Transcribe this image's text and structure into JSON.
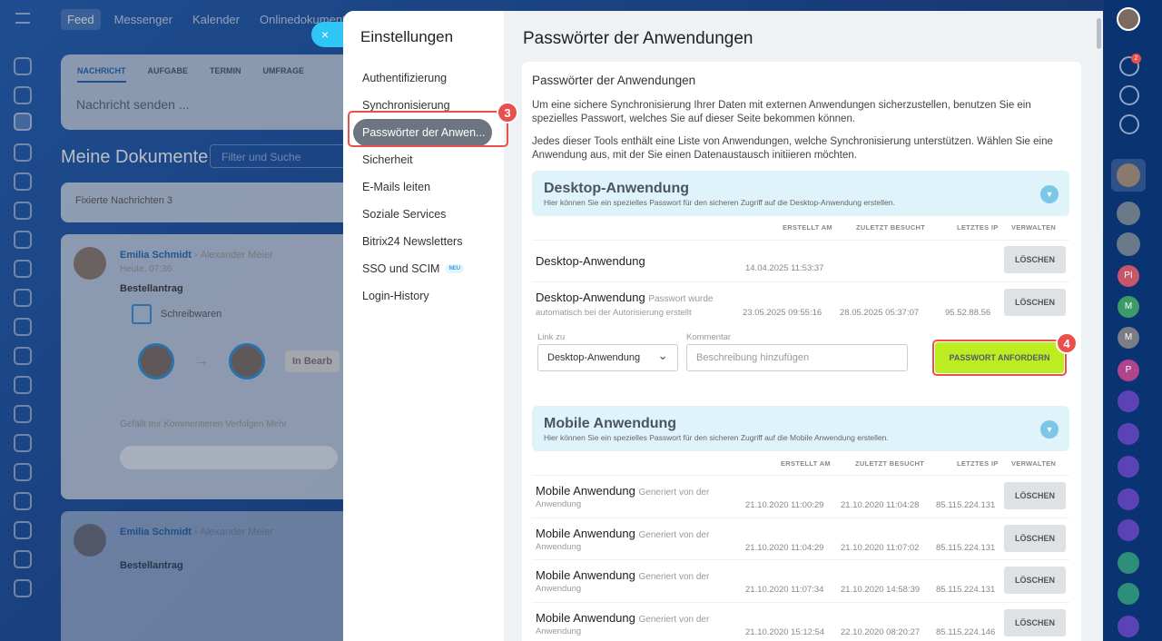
{
  "topnav": [
    "Feed",
    "Messenger",
    "Kalender",
    "Onlinedokumente"
  ],
  "composer": {
    "tabs": [
      "NACHRICHT",
      "AUFGABE",
      "TERMIN",
      "UMFRAGE"
    ],
    "placeholder": "Nachricht senden ..."
  },
  "docs": {
    "title": "Meine Dokumente",
    "filter_placeholder": "Filter und Suche",
    "pinned": "Fixierte Nachrichten 3"
  },
  "post": {
    "author": "Emilia Schmidt",
    "recipient": "Alexander Meier",
    "time": "Heute, 07:36",
    "subject": "Bestellantrag",
    "attachment": "Schreibwaren",
    "status": "In Bearb",
    "actions": "Gefällt mir   Kommentieren   Verfolgen   Mehr"
  },
  "post2": {
    "author": "Emilia Schmidt",
    "recipient": "Alexander Meier",
    "subject": "Bestellantrag"
  },
  "settings": {
    "title": "Einstellungen",
    "menu": [
      "Authentifizierung",
      "Synchronisierung",
      "Passwörter der Anwen...",
      "Sicherheit",
      "E-Mails leiten",
      "Soziale Services",
      "Bitrix24 Newsletters",
      "SSO und SCIM",
      "Login-History"
    ],
    "badge_new": "NEU",
    "step3": "3",
    "step4": "4"
  },
  "page": {
    "title": "Passwörter der Anwendungen",
    "card_title": "Passwörter der Anwendungen",
    "intro1": "Um eine sichere Synchronisierung Ihrer Daten mit externen Anwendungen sicherzustellen, benutzen Sie ein spezielles Passwort, welches Sie auf dieser Seite bekommen können.",
    "intro2": "Jedes dieser Tools enthält eine Liste von Anwendungen, welche Synchronisierung unterstützen. Wählen Sie eine Anwendung aus, mit der Sie einen Datenaustausch initiieren möchten."
  },
  "columns": {
    "created": "ERSTELLT AM",
    "visited": "ZULETZT BESUCHT",
    "ip": "LETZTES IP",
    "manage": "VERWALTEN"
  },
  "desktop": {
    "title": "Desktop-Anwendung",
    "desc": "Hier können Sie ein spezielles Passwort für den sicheren Zugriff auf die Desktop-Anwendung erstellen.",
    "rows": [
      {
        "name": "Desktop-Anwendung",
        "note": "",
        "sub": "",
        "created": "14.04.2025 11:53:37",
        "visited": "",
        "ip": ""
      },
      {
        "name": "Desktop-Anwendung",
        "note": "Passwort wurde",
        "sub": "automatisch bei der Autorisierung erstellt",
        "created": "23.05.2025 09:55:16",
        "visited": "28.05.2025 05:37:07",
        "ip": "95.52.88.56"
      }
    ],
    "link_label": "Link zu",
    "select_value": "Desktop-Anwendung",
    "comment_label": "Kommentar",
    "comment_placeholder": "Beschreibung hinzufügen",
    "request_button": "PASSWORT ANFORDERN"
  },
  "mobile": {
    "title": "Mobile Anwendung",
    "desc": "Hier können Sie ein spezielles Passwort für den sicheren Zugriff auf die Mobile Anwendung erstellen.",
    "rows": [
      {
        "name": "Mobile Anwendung",
        "note": "Generiert von der",
        "sub": "Anwendung",
        "created": "21.10.2020 11:00:29",
        "visited": "21.10.2020 11:04:28",
        "ip": "85.115.224.131"
      },
      {
        "name": "Mobile Anwendung",
        "note": "Generiert von der",
        "sub": "Anwendung",
        "created": "21.10.2020 11:04:29",
        "visited": "21.10.2020 11:07:02",
        "ip": "85.115.224.131"
      },
      {
        "name": "Mobile Anwendung",
        "note": "Generiert von der",
        "sub": "Anwendung",
        "created": "21.10.2020 11:07:34",
        "visited": "21.10.2020 14:58:39",
        "ip": "85.115.224.131"
      },
      {
        "name": "Mobile Anwendung",
        "note": "Generiert von der",
        "sub": "Anwendung",
        "created": "21.10.2020 15:12:54",
        "visited": "22.10.2020 08:20:27",
        "ip": "85.115.224.146"
      }
    ]
  },
  "delete_label": "LÖSCHEN",
  "right_rail": {
    "notif_count": "2",
    "letters": [
      "PI",
      "M",
      "M",
      "P"
    ]
  },
  "colors": {
    "accent": "#2fc6f6",
    "request": "#bbed21",
    "highlight": "#e9504b",
    "section": "#dff3fa"
  }
}
